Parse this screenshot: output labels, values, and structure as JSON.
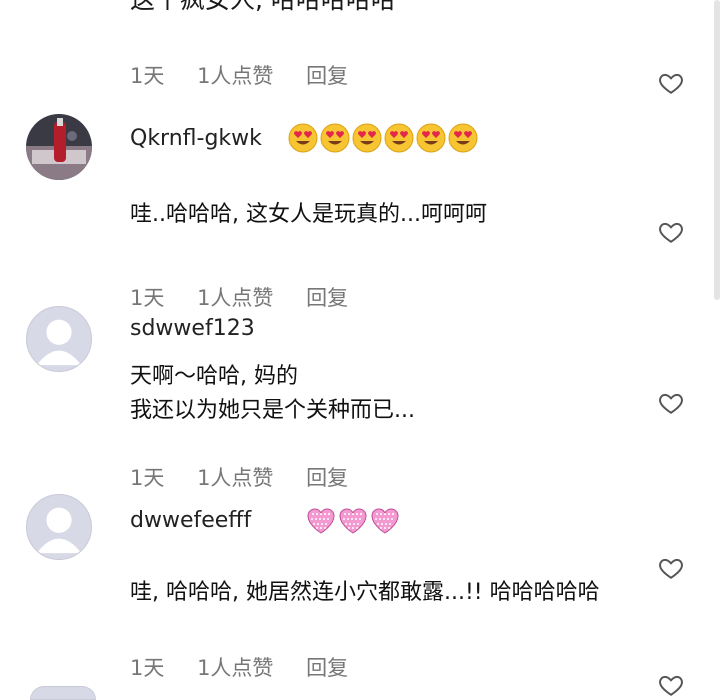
{
  "top_fragment": "这个疯女人, 哈哈哈哈哈",
  "comments": [
    {
      "meta": {
        "time": "1天",
        "likes": "1人点赞",
        "reply": "回复"
      },
      "like_icon": "heart-outline-icon"
    },
    {
      "username": "Qkrnfl-gkwk",
      "emojis": "😍😍😍😍😍😍",
      "text": "哇..哈哈哈, 这女人是玩真的...呵呵呵",
      "meta": {
        "time": "1天",
        "likes": "1人点赞",
        "reply": "回复"
      },
      "like_icon": "heart-outline-icon"
    },
    {
      "username": "sdwwef123",
      "text_line1": "天啊～哈哈, 妈的",
      "text_line2": "我还以为她只是个关种而已...",
      "meta": {
        "time": "1天",
        "likes": "1人点赞",
        "reply": "回复"
      },
      "like_icon": "heart-outline-icon"
    },
    {
      "username": "dwwefeefff",
      "emojis": "💗💗💗",
      "text": "哇, 哈哈哈, 她居然连小穴都敢露...!! 哈哈哈哈哈",
      "meta": {
        "time": "1天",
        "likes": "1人点赞",
        "reply": "回复"
      },
      "like_icon": "heart-outline-icon"
    }
  ]
}
